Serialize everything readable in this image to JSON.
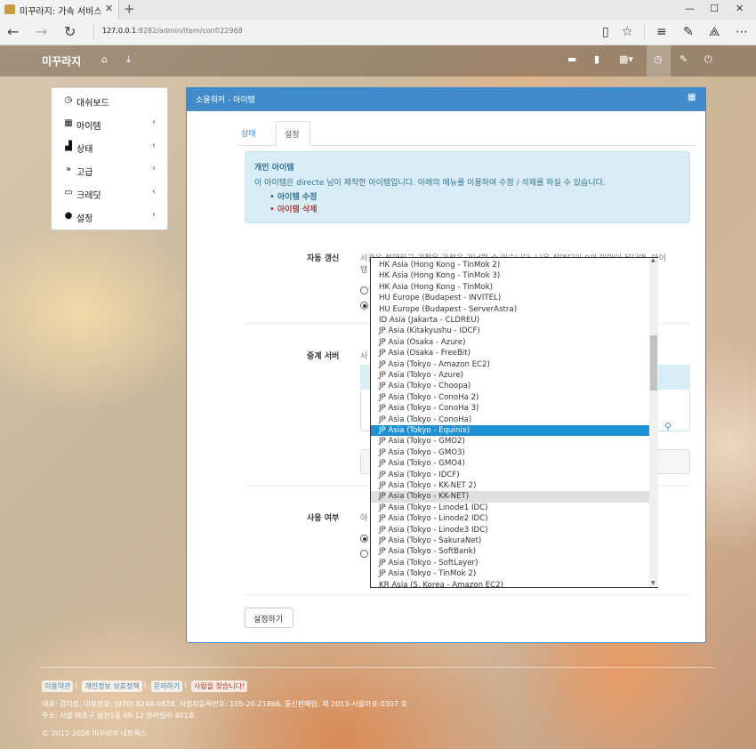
{
  "browser": {
    "tab_title": "미꾸라지: 가속 서비스",
    "url_host": "127.0.0.1",
    "url_path": ":8282/admin/item/conf/22968"
  },
  "navbar": {
    "brand": "미꾸라지"
  },
  "sidebar": {
    "items": [
      {
        "label": "대쉬보드",
        "icon": "clock-icon"
      },
      {
        "label": "아이템",
        "icon": "gift-icon"
      },
      {
        "label": "상태",
        "icon": "bar-chart-icon"
      },
      {
        "label": "고급",
        "icon": "fast-forward-icon"
      },
      {
        "label": "크레딧",
        "icon": "credit-card-icon"
      },
      {
        "label": "설정",
        "icon": "user-icon"
      }
    ]
  },
  "panel": {
    "title": "소울워커 - 아이템",
    "tabs": [
      "상태",
      "설정"
    ],
    "alert_title": "개인 아이템",
    "alert_text": "이 아이템은 directe 님이 제작한 아이템입니다. 아래의 메뉴를 이용하여 수정 / 삭제를 하실 수 있습니다.",
    "alert_links": [
      "아이템 수정",
      "아이템 삭제"
    ],
    "auto_refresh_label": "자동 갱신",
    "auto_refresh_help": "시간을 절약하고 귀찮은 과정을 건너뛸 수 있습니다. 나은 장연되이 0의 미만이 된다면, 아이",
    "auto_refresh_help2": "템",
    "relay_label": "중계 서버",
    "relay_help": "사",
    "use_label": "사용 여부",
    "use_help": "아",
    "save_button": "설정하기"
  },
  "dropdown": {
    "options": [
      "HK Asia (Hong Kong - TinMok 2)",
      "HK Asia (Hong Kong - TinMok 3)",
      "HK Asia (Hong Kong - TinMok)",
      "HU Europe (Budapest - INVITEL)",
      "HU Europe (Budapest - ServerAstra)",
      "ID Asia (Jakarta - CLDREU)",
      "JP Asia (Kitakyushu - IDCF)",
      "JP Asia (Osaka - Azure)",
      "JP Asia (Osaka - FreeBit)",
      "JP Asia (Tokyo - Amazon EC2)",
      "JP Asia (Tokyo - Azure)",
      "JP Asia (Tokyo - Choopa)",
      "JP Asia (Tokyo - ConoHa 2)",
      "JP Asia (Tokyo - ConoHa 3)",
      "JP Asia (Tokyo - ConoHa)",
      "JP Asia (Tokyo - Equinix)",
      "JP Asia (Tokyo - GMO2)",
      "JP Asia (Tokyo - GMO3)",
      "JP Asia (Tokyo - GMO4)",
      "JP Asia (Tokyo - IDCF)",
      "JP Asia (Tokyo - KK-NET 2)",
      "JP Asia (Tokyo - KK-NET)",
      "JP Asia (Tokyo - Linode1 IDC)",
      "JP Asia (Tokyo - Linode2 IDC)",
      "JP Asia (Tokyo - Linode3 IDC)",
      "JP Asia (Tokyo - SakuraNet)",
      "JP Asia (Tokyo - SoftBank)",
      "JP Asia (Tokyo - SoftLayer)",
      "JP Asia (Tokyo - TinMok 2)",
      "KR Asia (S. Korea - Amazon EC2)"
    ],
    "selected": "JP Asia (Tokyo - Equinix)",
    "hovered": "JP Asia (Tokyo - KK-NET)"
  },
  "footer": {
    "links": [
      "이용약관",
      "개인정보 보호정책",
      "문의하기",
      "사람을 찾습니다!"
    ],
    "line1": "대표: 김미정, 대표번호: (070) 8248-0828, 사업자등록번호: 105-20-21866, 통신판매업: 제 2013-서울마포-0307 호",
    "line2": "주소: 서울 마포구 성산1동 49-12 한라빌라 401호",
    "copyright": "© 2011-2016 미꾸라지 네트웍스"
  },
  "colors": {
    "primary": "#428bca",
    "selected_option": "#1e90d6",
    "alert_bg": "#d9edf7",
    "alert_text": "#31708f"
  }
}
